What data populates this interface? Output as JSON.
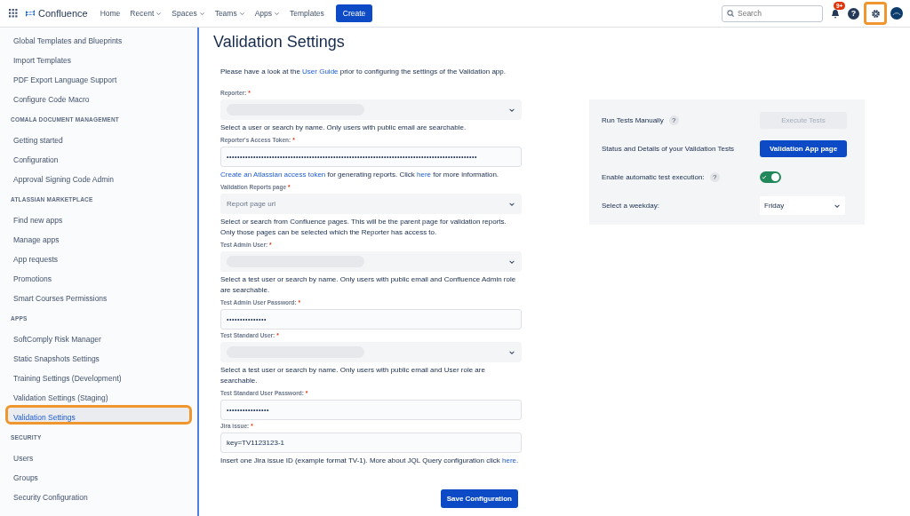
{
  "top_nav": {
    "product": "Confluence",
    "links": [
      {
        "label": "Home",
        "dropdown": false
      },
      {
        "label": "Recent",
        "dropdown": true
      },
      {
        "label": "Spaces",
        "dropdown": true
      },
      {
        "label": "Teams",
        "dropdown": true
      },
      {
        "label": "Apps",
        "dropdown": true
      },
      {
        "label": "Templates",
        "dropdown": false
      }
    ],
    "create_button": "Create",
    "search": {
      "placeholder": "Search"
    },
    "notifications_badge": "9+",
    "help_label": "?",
    "settings_highlighted": true
  },
  "sidebar": {
    "sections": [
      {
        "items": [
          {
            "label": "Global Templates and Blueprints",
            "selected": false,
            "highlighted": false
          },
          {
            "label": "Import Templates",
            "selected": false,
            "highlighted": false
          },
          {
            "label": "PDF Export Language Support",
            "selected": false,
            "highlighted": false
          },
          {
            "label": "Configure Code Macro",
            "selected": false,
            "highlighted": false
          }
        ]
      },
      {
        "heading": "COMALA DOCUMENT MANAGEMENT",
        "items": [
          {
            "label": "Getting started",
            "selected": false,
            "highlighted": false
          },
          {
            "label": "Configuration",
            "selected": false,
            "highlighted": false
          },
          {
            "label": "Approval Signing Code Admin",
            "selected": false,
            "highlighted": false
          }
        ]
      },
      {
        "heading": "ATLASSIAN MARKETPLACE",
        "items": [
          {
            "label": "Find new apps",
            "selected": false,
            "highlighted": false
          },
          {
            "label": "Manage apps",
            "selected": false,
            "highlighted": false
          },
          {
            "label": "App requests",
            "selected": false,
            "highlighted": false
          },
          {
            "label": "Promotions",
            "selected": false,
            "highlighted": false
          },
          {
            "label": "Smart Courses Permissions",
            "selected": false,
            "highlighted": false
          }
        ]
      },
      {
        "heading": "APPS",
        "items": [
          {
            "label": "SoftComply Risk Manager",
            "selected": false,
            "highlighted": false
          },
          {
            "label": "Static Snapshots Settings",
            "selected": false,
            "highlighted": false
          },
          {
            "label": "Training Settings (Development)",
            "selected": false,
            "highlighted": false
          },
          {
            "label": "Validation Settings (Staging)",
            "selected": false,
            "highlighted": false
          },
          {
            "label": "Validation Settings",
            "selected": true,
            "highlighted": true
          }
        ]
      },
      {
        "heading": "SECURITY",
        "items": [
          {
            "label": "Users",
            "selected": false,
            "highlighted": false
          },
          {
            "label": "Groups",
            "selected": false,
            "highlighted": false
          },
          {
            "label": "Security Configuration",
            "selected": false,
            "highlighted": false
          }
        ]
      }
    ]
  },
  "page": {
    "title": "Validation Settings",
    "intro": [
      {
        "kind": "text",
        "text": "Please have a look at the "
      },
      {
        "kind": "link",
        "text": "User Guide"
      },
      {
        "kind": "text",
        "text": " prior to configuring the settings of the Validation app."
      }
    ]
  },
  "form": {
    "required_mark": "*",
    "fields": [
      {
        "kind": "select",
        "label": "Reporter:",
        "redacted": true,
        "help": [
          {
            "kind": "text",
            "text": "Select a user or search by name. Only users with public email are searchable."
          }
        ]
      },
      {
        "kind": "password",
        "label": "Reporter's Access Token:",
        "value": "••••••••••••••••••••••••••••••••••••••••••••••••••••••••••••••••••••••••••••••••••••••••••••••",
        "help": [
          {
            "kind": "link",
            "text": "Create an Atlassian access token"
          },
          {
            "kind": "text",
            "text": " for generating reports. Click "
          },
          {
            "kind": "link",
            "text": "here"
          },
          {
            "kind": "text",
            "text": "  for more information."
          }
        ]
      },
      {
        "kind": "select",
        "label": "Validation Reports page",
        "placeholder": "Report page url",
        "redacted": false,
        "help": [
          {
            "kind": "text",
            "text": "Select or search from Confluence pages. This will be the parent page for validation reports. Only those pages can be selected which the Reporter has access to."
          }
        ]
      },
      {
        "kind": "select",
        "label": "Test Admin User:",
        "redacted": true,
        "help": [
          {
            "kind": "text",
            "text": "Select a test user or search by name. Only users with public email and Confluence Admin role are searchable."
          }
        ]
      },
      {
        "kind": "password",
        "label": "Test Admin User Password:",
        "value": "•••••••••••••••"
      },
      {
        "kind": "select",
        "label": "Test Standard User:",
        "redacted": true,
        "help": [
          {
            "kind": "text",
            "text": "Select a test user or search by name. Only users with public email and User role are searchable."
          }
        ]
      },
      {
        "kind": "password",
        "label": "Test Standard User Password:",
        "value": "••••••••••••••••"
      },
      {
        "kind": "text",
        "label": "Jira issue:",
        "value": "key=TV1123123-1",
        "help": [
          {
            "kind": "text",
            "text": "Insert one Jira issue ID (example format TV-1). More about JQL Query configuration click "
          },
          {
            "kind": "link",
            "text": "here"
          },
          {
            "kind": "text",
            "text": "."
          }
        ]
      }
    ],
    "save_button": "Save Configuration"
  },
  "test_panel": {
    "rows": [
      {
        "kind": "button",
        "label": "Run Tests Manually",
        "help_icon": "?",
        "button": {
          "label": "Execute Tests",
          "disabled": true
        }
      },
      {
        "kind": "button",
        "label": "Status and Details of your Validation Tests",
        "button": {
          "label": "Validation App page",
          "disabled": false
        }
      },
      {
        "kind": "toggle",
        "label": "Enable automatic test execution:",
        "help_icon": "?",
        "on": true
      },
      {
        "kind": "select",
        "label": "Select a weekday:",
        "value": "Friday"
      }
    ]
  }
}
